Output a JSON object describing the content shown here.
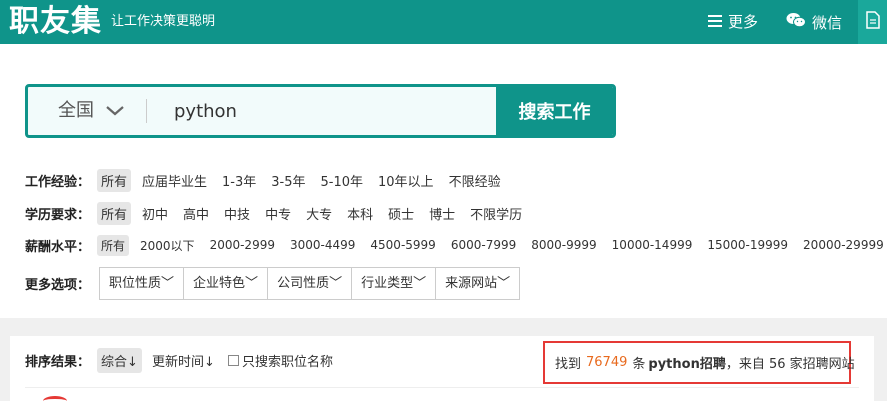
{
  "header": {
    "logo": "职友集",
    "slogan": "让工作决策更聪明",
    "more_label": "更多",
    "wechat_label": "微信",
    "bg_color": "#0f948a"
  },
  "search": {
    "city": "全国",
    "query": "python",
    "button_label": "搜索工作"
  },
  "filters": {
    "experience": {
      "label": "工作经验：",
      "options": [
        "所有",
        "应届毕业生",
        "1-3年",
        "3-5年",
        "5-10年",
        "10年以上",
        "不限经验"
      ]
    },
    "education": {
      "label": "学历要求：",
      "options": [
        "所有",
        "初中",
        "高中",
        "中技",
        "中专",
        "大专",
        "本科",
        "硕士",
        "博士",
        "不限学历"
      ]
    },
    "salary": {
      "label": "薪酬水平：",
      "options": [
        "所有",
        "2000以下",
        "2000-2999",
        "3000-4499",
        "4500-5999",
        "6000-7999",
        "8000-9999",
        "10000-14999",
        "15000-19999",
        "20000-29999"
      ]
    },
    "more": {
      "label": "更多选项：",
      "dropdowns": [
        "职位性质",
        "企业特色",
        "公司性质",
        "行业类型",
        "来源网站"
      ]
    }
  },
  "results": {
    "sort_label": "排序结果：",
    "sort_options": [
      "综合↓",
      "更新时间↓"
    ],
    "only_title_label": "只搜索职位名称",
    "prefix": "找到",
    "count": "76749",
    "middle": "条",
    "keyword_bold": "python招聘",
    "suffix": "，来自 56 家招聘网站"
  }
}
